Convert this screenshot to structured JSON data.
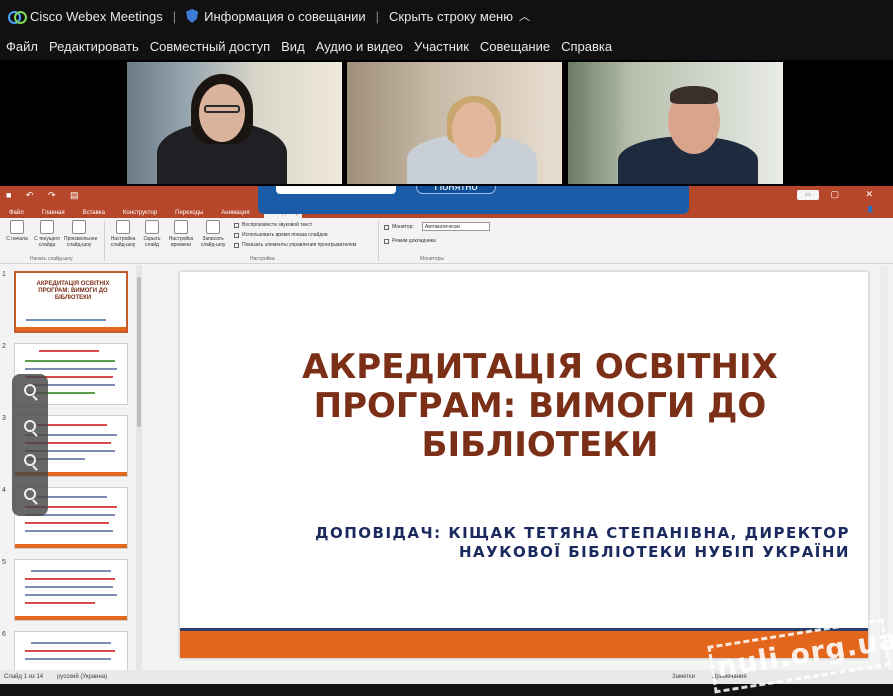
{
  "webex": {
    "app_title": "Cisco Webex Meetings",
    "meeting_info": "Информация о совещании",
    "hide_menu": "Скрыть строку меню",
    "menu": [
      "Файл",
      "Редактировать",
      "Совместный доступ",
      "Вид",
      "Аудио и видео",
      "Участник",
      "Совещание",
      "Справка"
    ],
    "banner_button": "Понятно"
  },
  "powerpoint": {
    "tabs": [
      "Файл",
      "Главная",
      "Вставка",
      "Конструктор",
      "Переходы",
      "Анимация",
      "Слайд-шоу"
    ],
    "active_tab": "Слайд-шоу",
    "ribbon": {
      "buttons": [
        "С начала",
        "С текущего слайда",
        "Произвольное слайд-шоу",
        "Настройка слайд-шоу",
        "Скрыть слайд",
        "Настройка времени",
        "Записать слайд-шоу"
      ],
      "group_start": "Начать слайд-шоу",
      "group_setup": "Настройка",
      "group_monitors": "Мониторы",
      "checks": [
        "Воспроизвести звуковой текст",
        "Использовать время показа слайдов",
        "Показать элементы управления проигрывателем"
      ],
      "monitor_label": "Монитор:",
      "monitor_value": "Автоматически",
      "presenter_view": "Режим докладчика"
    },
    "thumb_numbers": [
      "1",
      "2",
      "3",
      "4",
      "5",
      "6"
    ],
    "thumb1_title": "АКРЕДИТАЦІЯ ОСВІТНІХ ПРОГРАМ: ВИМОГИ ДО БІБЛІОТЕКИ",
    "status_left": "Слайд 1 из 14",
    "status_lang": "русский (Украина)",
    "status_notes": "Заметки",
    "status_comments": "Примечания"
  },
  "slide": {
    "title": "АКРЕДИТАЦІЯ ОСВІТНІХ ПРОГРАМ: ВИМОГИ ДО БІБЛІОТЕКИ",
    "subtitle_line1": "ДОПОВІДАЧ: КІЩАК ТЕТЯНА СТЕПАНІВНА, ДИРЕКТОР",
    "subtitle_line2": "НАУКОВОЇ БІБЛІОТЕКИ НУБІП УКРАЇНИ"
  },
  "watermark": "nuli.org.ua",
  "colors": {
    "ppt_accent": "#b7472a",
    "slide_title": "#7a2f16",
    "slide_subtitle": "#1b2a5e",
    "slide_bar": "#e2671c",
    "banner": "#1a5ca8"
  }
}
